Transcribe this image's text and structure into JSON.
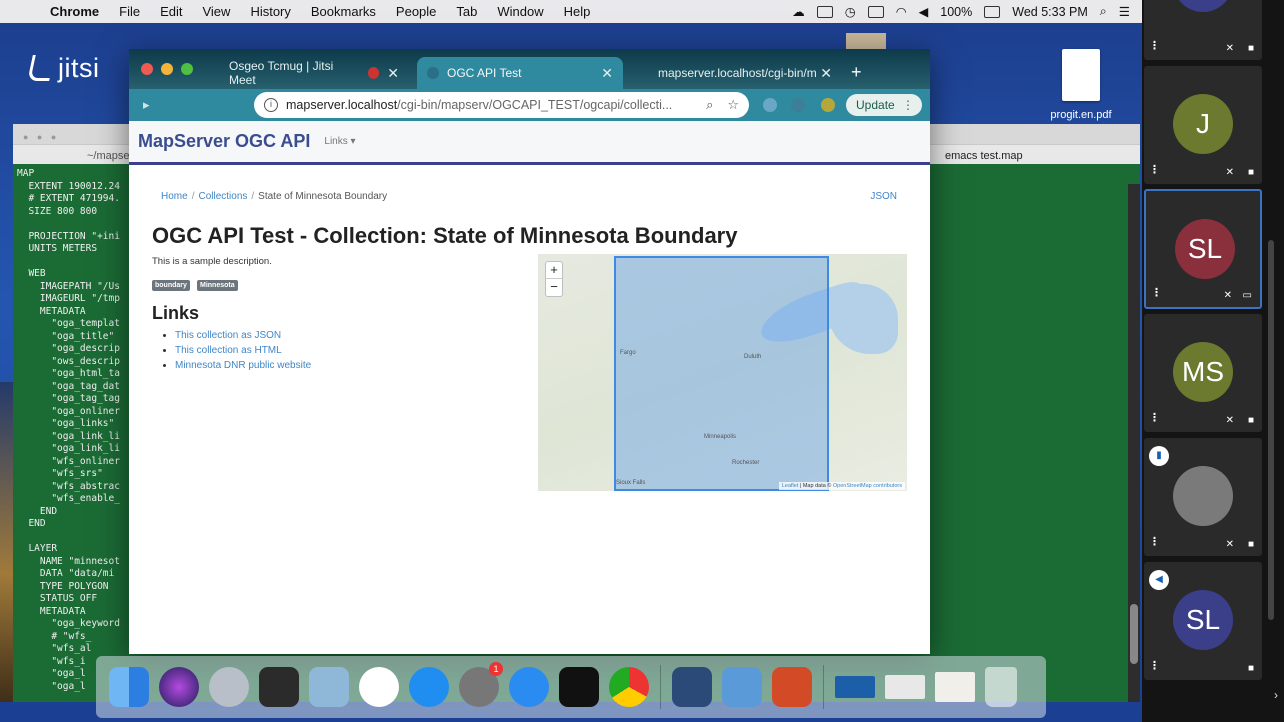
{
  "menubar": {
    "app": "Chrome",
    "items": [
      "File",
      "Edit",
      "View",
      "History",
      "Bookmarks",
      "People",
      "Tab",
      "Window",
      "Help"
    ],
    "battery": "100%",
    "clock": "Wed 5:33 PM"
  },
  "desktop": {
    "jitsi_logo": "jitsi",
    "file_label": "progit.en.pdf"
  },
  "emacs": {
    "title_left": "~/mapse",
    "title_right": "emacs test.map",
    "code": "MAP\n  EXTENT 190012.24\n  # EXTENT 471994.\n  SIZE 800 800\n\n  PROJECTION \"+ini\n  UNITS METERS\n\n  WEB\n    IMAGEPATH \"/Us\n    IMAGEURL \"/tmp\n    METADATA\n      \"oga_templat\n      \"oga_title\"\n      \"oga_descrip\n      \"ows_descrip\n      \"oga_html_ta\n      \"oga_tag_dat\n      \"oga_tag_tag\n      \"oga_onliner\n      \"oga_links\"\n      \"oga_link_li\n      \"oga_link_li\n      \"wfs_onliner\n      \"wfs_srs\"\n      \"wfs_abstrac\n      \"wfs_enable_\n    END\n  END\n\n  LAYER\n    NAME \"minnesot\n    DATA \"data/mi\n    TYPE POLYGON\n    STATUS OFF\n    METADATA\n      \"oga_keyword\n      # \"wfs_\n      \"wfs_al\n      \"wfs_i\n      \"oga_l\n      \"oga_l"
  },
  "chrome": {
    "tabs": [
      {
        "label": "Osgeo Tcmug | Jitsi Meet",
        "active": false
      },
      {
        "label": "OGC API Test",
        "active": true
      },
      {
        "label": "mapserver.localhost/cgi-bin/m",
        "active": false
      }
    ],
    "url_host": "mapserver.localhost",
    "url_path": "/cgi-bin/mapserv/OGCAPI_TEST/ogcapi/collecti...",
    "update_label": "Update"
  },
  "page": {
    "brand": "MapServer OGC API",
    "nav_links": "Links ▾",
    "breadcrumb": {
      "home": "Home",
      "collections": "Collections",
      "current": "State of Minnesota Boundary"
    },
    "json_link": "JSON",
    "title": "OGC API Test - Collection: State of Minnesota Boundary",
    "description": "This is a sample description.",
    "tags": [
      "boundary",
      "Minnesota"
    ],
    "links_heading": "Links",
    "links": [
      "This collection as JSON",
      "This collection as HTML",
      "Minnesota DNR public website"
    ],
    "map": {
      "zoom_in": "+",
      "zoom_out": "−",
      "places": [
        "Duluth",
        "Minneapolis",
        "Fargo",
        "Rochester",
        "Sioux Falls"
      ],
      "attribution_leaflet": "Leaflet",
      "attribution_text": "| Map data ©",
      "attribution_osm": "OpenStreetMap contributors"
    }
  },
  "filmstrip": {
    "participants": [
      {
        "initials": "",
        "color": "#3b3f8a",
        "active": false
      },
      {
        "initials": "J",
        "color": "#6b7a2e",
        "active": false
      },
      {
        "initials": "SL",
        "color": "#8a2f3c",
        "active": true
      },
      {
        "initials": "MS",
        "color": "#6b7a2e",
        "active": false
      },
      {
        "initials": "",
        "color": "#7a7a7a",
        "active": false
      },
      {
        "initials": "SL",
        "color": "#3b3f8a",
        "active": false
      }
    ]
  },
  "colors": {
    "brand": "#3a4d8f",
    "link": "#3f86c7",
    "bbox": "#3d8ae0",
    "chrome_toolbar": "#2f8aa0"
  }
}
